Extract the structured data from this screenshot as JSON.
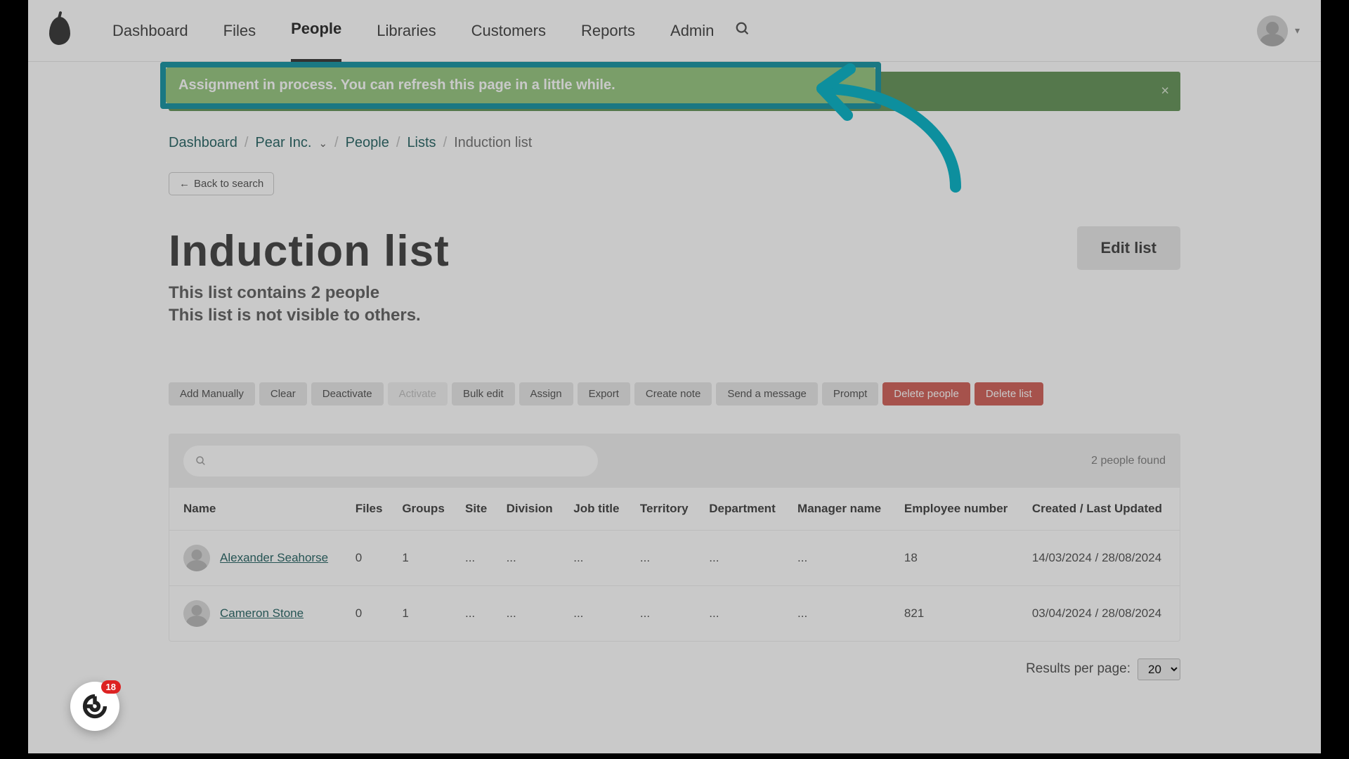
{
  "nav": {
    "items": [
      "Dashboard",
      "Files",
      "People",
      "Libraries",
      "Customers",
      "Reports",
      "Admin"
    ],
    "active_index": 2
  },
  "alert": {
    "message": "Assignment in process. You can refresh this page in a little while."
  },
  "breadcrumbs": {
    "items": [
      "Dashboard",
      "Pear Inc.",
      "People",
      "Lists",
      "Induction list"
    ],
    "dropdown_after_index": 1
  },
  "back_button": "Back to search",
  "page": {
    "title": "Induction list",
    "subtitle_line1": "This list contains 2 people",
    "subtitle_line2": "This list is not visible to others.",
    "edit_label": "Edit list"
  },
  "actions": [
    {
      "label": "Add Manually",
      "kind": "normal"
    },
    {
      "label": "Clear",
      "kind": "normal"
    },
    {
      "label": "Deactivate",
      "kind": "normal"
    },
    {
      "label": "Activate",
      "kind": "disabled"
    },
    {
      "label": "Bulk edit",
      "kind": "normal"
    },
    {
      "label": "Assign",
      "kind": "normal"
    },
    {
      "label": "Export",
      "kind": "normal"
    },
    {
      "label": "Create note",
      "kind": "normal"
    },
    {
      "label": "Send a message",
      "kind": "normal"
    },
    {
      "label": "Prompt",
      "kind": "normal"
    },
    {
      "label": "Delete people",
      "kind": "danger"
    },
    {
      "label": "Delete list",
      "kind": "danger"
    }
  ],
  "table": {
    "found_label": "2 people found",
    "columns": [
      "Name",
      "Files",
      "Groups",
      "Site",
      "Division",
      "Job title",
      "Territory",
      "Department",
      "Manager name",
      "Employee number",
      "Created / Last Updated"
    ],
    "rows": [
      {
        "name": "Alexander Seahorse",
        "files": "0",
        "groups": "1",
        "site": "...",
        "division": "...",
        "job": "...",
        "territory": "...",
        "department": "...",
        "manager": "...",
        "empno": "18",
        "dates": "14/03/2024 / 28/08/2024"
      },
      {
        "name": "Cameron Stone",
        "files": "0",
        "groups": "1",
        "site": "...",
        "division": "...",
        "job": "...",
        "territory": "...",
        "department": "...",
        "manager": "...",
        "empno": "821",
        "dates": "03/04/2024 / 28/08/2024"
      }
    ]
  },
  "pager": {
    "label": "Results per page:",
    "value": "20"
  },
  "widget_badge": "18",
  "colors": {
    "accent_teal": "#0d8f9e",
    "alert_green_dark": "#5f8f53",
    "alert_green_light": "#92c47a",
    "danger": "#cf5a52",
    "link": "#1e5e5e"
  }
}
